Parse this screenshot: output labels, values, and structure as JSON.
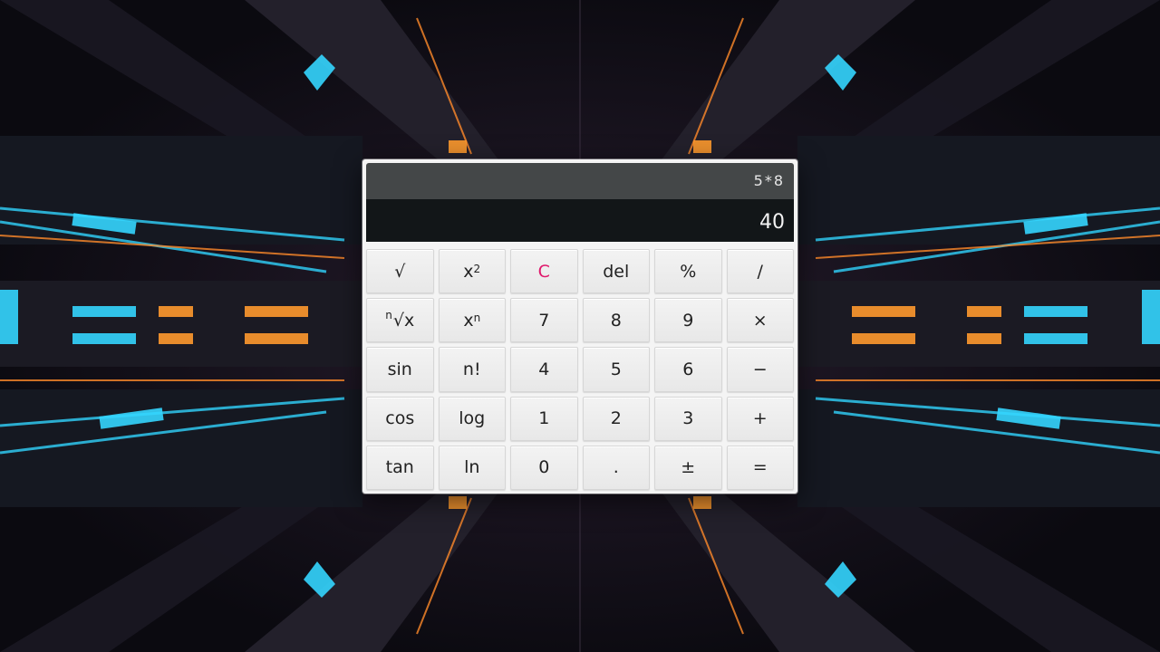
{
  "display": {
    "expression": "5*8",
    "result": "40"
  },
  "keys": [
    {
      "name": "sqrt-button",
      "label": "√"
    },
    {
      "name": "square-button",
      "base": "x",
      "sup": "2"
    },
    {
      "name": "clear-button",
      "label": "C"
    },
    {
      "name": "delete-button",
      "label": "del"
    },
    {
      "name": "percent-button",
      "label": "%"
    },
    {
      "name": "divide-button",
      "label": "/"
    },
    {
      "name": "nth-root-button",
      "pre": "n",
      "label": "√x"
    },
    {
      "name": "power-button",
      "base": "x",
      "sup": "n"
    },
    {
      "name": "digit-7-button",
      "label": "7"
    },
    {
      "name": "digit-8-button",
      "label": "8"
    },
    {
      "name": "digit-9-button",
      "label": "9"
    },
    {
      "name": "multiply-button",
      "label": "×"
    },
    {
      "name": "sin-button",
      "label": "sin"
    },
    {
      "name": "factorial-button",
      "label": "n!"
    },
    {
      "name": "digit-4-button",
      "label": "4"
    },
    {
      "name": "digit-5-button",
      "label": "5"
    },
    {
      "name": "digit-6-button",
      "label": "6"
    },
    {
      "name": "subtract-button",
      "label": "−"
    },
    {
      "name": "cos-button",
      "label": "cos"
    },
    {
      "name": "log-button",
      "label": "log"
    },
    {
      "name": "digit-1-button",
      "label": "1"
    },
    {
      "name": "digit-2-button",
      "label": "2"
    },
    {
      "name": "digit-3-button",
      "label": "3"
    },
    {
      "name": "add-button",
      "label": "+"
    },
    {
      "name": "tan-button",
      "label": "tan"
    },
    {
      "name": "ln-button",
      "label": "ln"
    },
    {
      "name": "digit-0-button",
      "label": "0"
    },
    {
      "name": "decimal-button",
      "label": "."
    },
    {
      "name": "sign-toggle-button",
      "label": "±"
    },
    {
      "name": "equals-button",
      "label": "="
    }
  ],
  "colors": {
    "clear_accent": "#e0176b",
    "expression_bg": "#444748",
    "result_bg": "#121618",
    "key_bg": "#efefef"
  }
}
